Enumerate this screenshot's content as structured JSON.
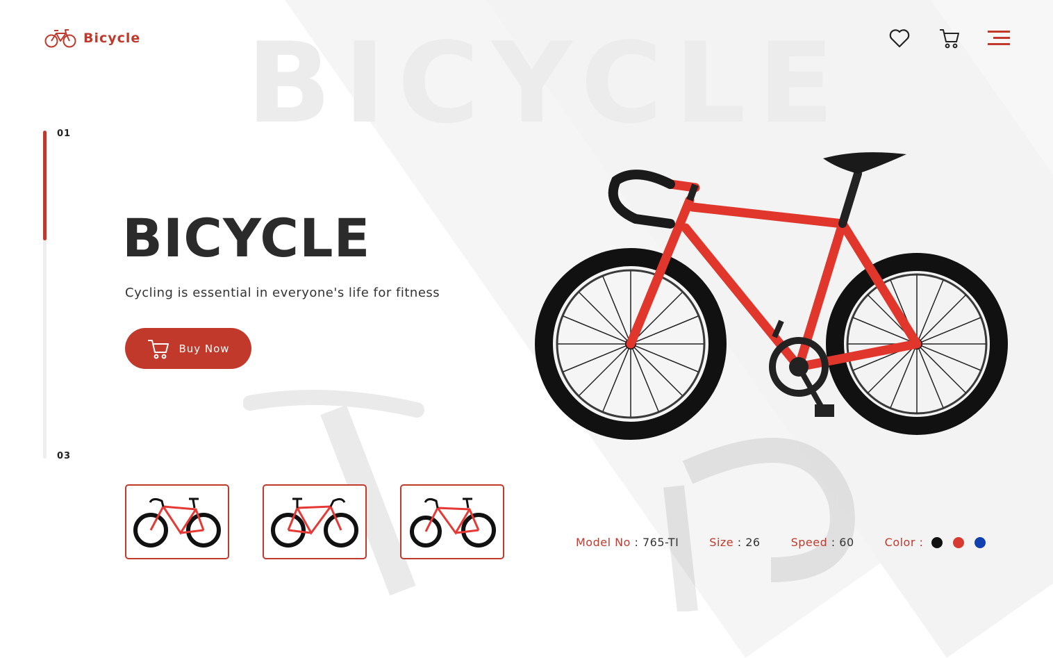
{
  "brand": {
    "name": "Bicycle",
    "accent_color": "#c0392b"
  },
  "header": {
    "icons": [
      "heart-icon",
      "cart-icon",
      "menu-icon"
    ]
  },
  "watermark": "BICYCLE",
  "slider": {
    "start_label": "01",
    "end_label": "03",
    "progress": 0.33
  },
  "hero": {
    "title": "BICYCLE",
    "subtitle": "Cycling is essential in everyone's life for fitness",
    "buy_button": "Buy Now"
  },
  "thumbnails": [
    {
      "frame_color": "#e53935"
    },
    {
      "frame_color": "#e53935"
    },
    {
      "frame_color": "#e53935"
    }
  ],
  "specs": {
    "model": {
      "label": "Model No",
      "value": "765-TI"
    },
    "size": {
      "label": "Size",
      "value": "26"
    },
    "speed": {
      "label": "Speed",
      "value": "60"
    },
    "color_label": "Color :",
    "colors": [
      "#111111",
      "#d63a30",
      "#1040b0"
    ]
  }
}
